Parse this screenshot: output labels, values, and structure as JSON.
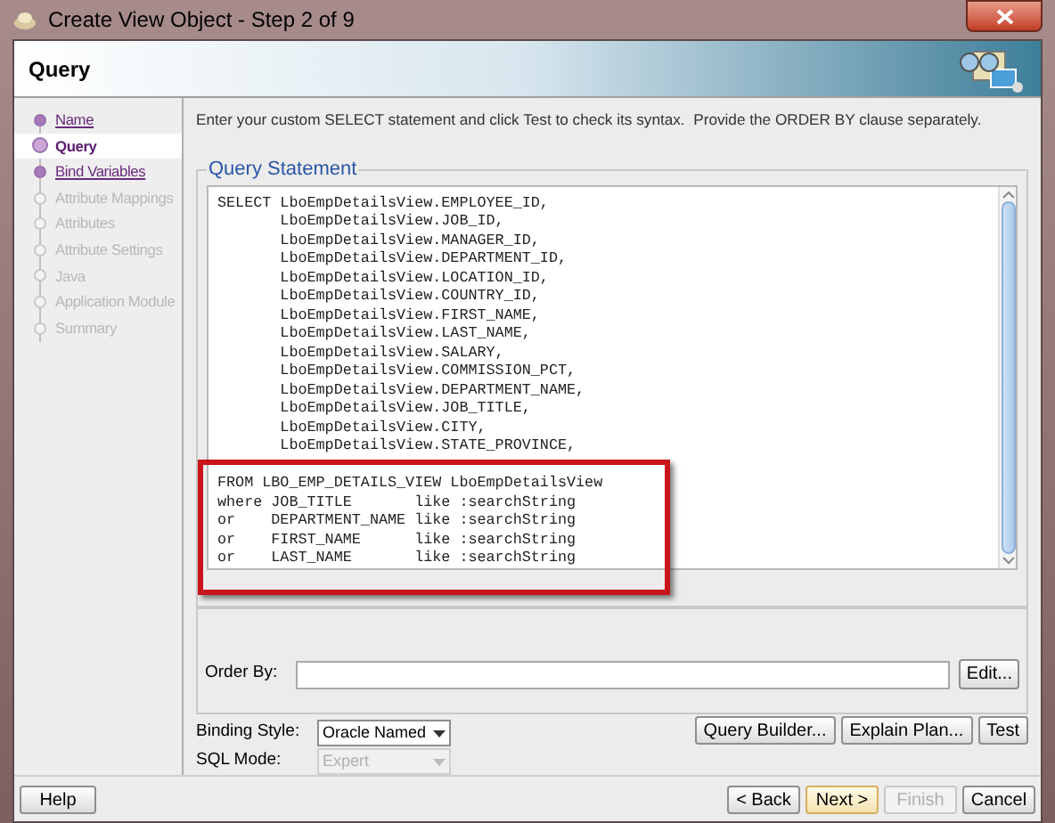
{
  "window": {
    "title": "Create View Object - Step 2 of 9"
  },
  "header": {
    "title": "Query"
  },
  "steps": [
    {
      "label": "Name",
      "selected": false,
      "enabled": true
    },
    {
      "label": "Query",
      "selected": true,
      "enabled": true
    },
    {
      "label": "Bind Variables",
      "selected": false,
      "enabled": true
    },
    {
      "label": "Attribute Mappings",
      "selected": false,
      "enabled": false
    },
    {
      "label": "Attributes",
      "selected": false,
      "enabled": false
    },
    {
      "label": "Attribute Settings",
      "selected": false,
      "enabled": false
    },
    {
      "label": "Java",
      "selected": false,
      "enabled": false
    },
    {
      "label": "Application Module",
      "selected": false,
      "enabled": false
    },
    {
      "label": "Summary",
      "selected": false,
      "enabled": false
    }
  ],
  "instructions": "Enter your custom SELECT statement and click Test to check its syntax.  Provide the ORDER BY clause separately.",
  "query_statement": {
    "legend": "Query Statement",
    "select_lines": [
      "SELECT LboEmpDetailsView.EMPLOYEE_ID,",
      "       LboEmpDetailsView.JOB_ID,",
      "       LboEmpDetailsView.MANAGER_ID,",
      "       LboEmpDetailsView.DEPARTMENT_ID,",
      "       LboEmpDetailsView.LOCATION_ID,",
      "       LboEmpDetailsView.COUNTRY_ID,",
      "       LboEmpDetailsView.FIRST_NAME,",
      "       LboEmpDetailsView.LAST_NAME,",
      "       LboEmpDetailsView.SALARY,",
      "       LboEmpDetailsView.COMMISSION_PCT,",
      "       LboEmpDetailsView.DEPARTMENT_NAME,",
      "       LboEmpDetailsView.JOB_TITLE,",
      "       LboEmpDetailsView.CITY,",
      "       LboEmpDetailsView.STATE_PROVINCE,"
    ],
    "from_lines": [
      "FROM LBO_EMP_DETAILS_VIEW LboEmpDetailsView",
      "where JOB_TITLE       like :searchString",
      "or    DEPARTMENT_NAME like :searchString",
      "or    FIRST_NAME      like :searchString",
      "or    LAST_NAME       like :searchString"
    ]
  },
  "query_clauses": {
    "order_by_label": "Order By:",
    "edit_button": "Edit..."
  },
  "binding_style": {
    "label": "Binding Style:",
    "value": "Oracle Named",
    "disabled": false
  },
  "sql_mode": {
    "label": "SQL Mode:",
    "value": "Expert",
    "disabled": true
  },
  "action_buttons": [
    "Query Builder...",
    "Explain Plan...",
    "Test"
  ],
  "help_button": "Help",
  "nav_buttons": [
    {
      "label": "< Back",
      "disabled": false,
      "default": false
    },
    {
      "label": "Next >",
      "disabled": false,
      "default": true
    },
    {
      "label": "Finish",
      "disabled": true,
      "default": false
    },
    {
      "label": "Cancel",
      "disabled": false,
      "default": false
    }
  ]
}
